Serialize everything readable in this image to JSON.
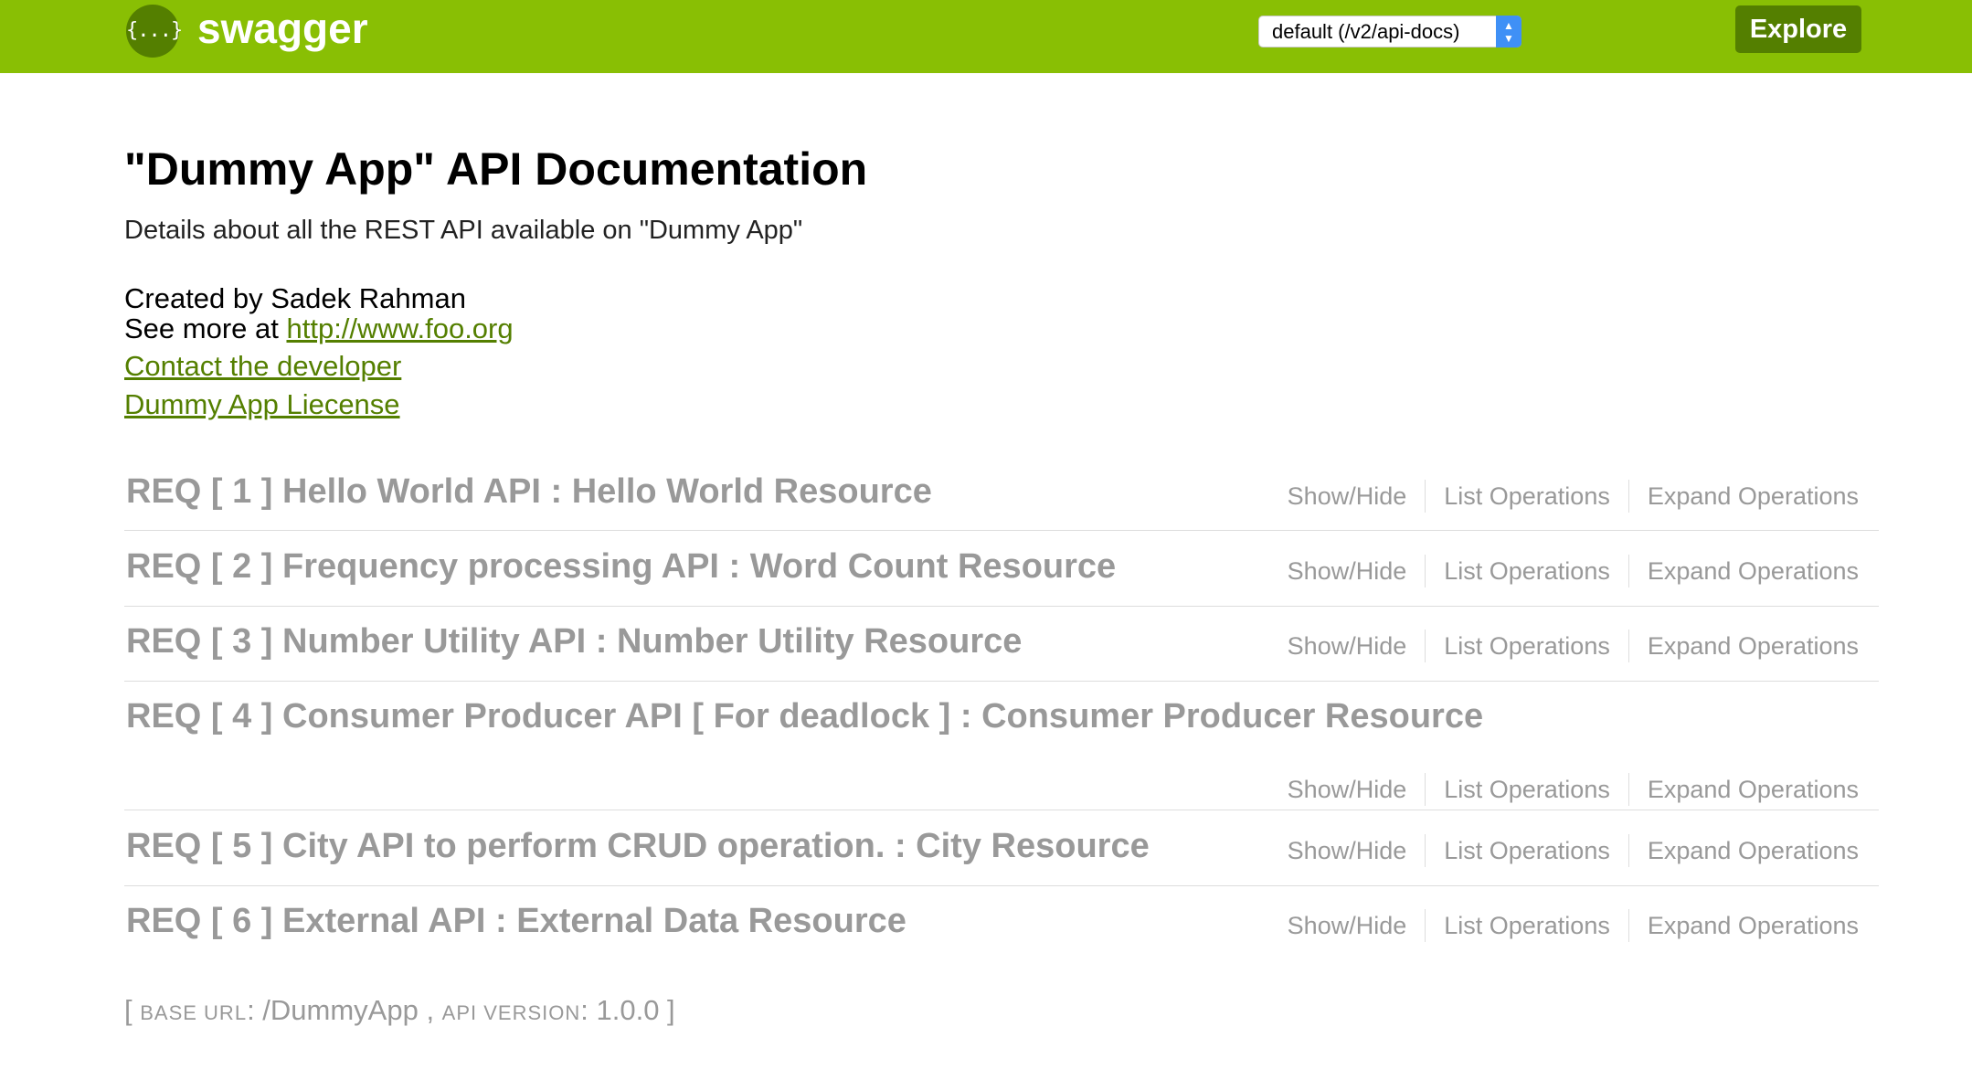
{
  "header": {
    "logo_icon_glyph": "{...}",
    "logo_text": "swagger",
    "spec_select_value": "default (/v2/api-docs)",
    "explore_label": "Explore",
    "background": "#89bf04",
    "accent": "#547f00"
  },
  "info": {
    "title": "\"Dummy App\" API Documentation",
    "description": "Details about all the REST API available on \"Dummy App\"",
    "created_by": "Created by Sadek Rahman",
    "see_more_prefix": "See more at ",
    "see_more_link": "http://www.foo.org",
    "contact_link": "Contact the developer",
    "license_link": "Dummy App Liecense"
  },
  "operations": {
    "show_hide": "Show/Hide",
    "list": "List Operations",
    "expand": "Expand Operations"
  },
  "resources": [
    {
      "title": "REQ [ 1 ] Hello World API : Hello World Resource"
    },
    {
      "title": "REQ [ 2 ] Frequency processing API : Word Count Resource"
    },
    {
      "title": "REQ [ 3 ] Number Utility API : Number Utility Resource"
    },
    {
      "title": "REQ [ 4 ] Consumer Producer API [ For deadlock ] : Consumer Producer Resource"
    },
    {
      "title": "REQ [ 5 ] City API to perform CRUD operation. : City Resource"
    },
    {
      "title": "REQ [ 6 ] External API : External Data Resource"
    }
  ],
  "footer": {
    "open_bracket": "[ ",
    "base_url_label": "base url",
    "base_url_value": ": /DummyApp , ",
    "api_version_label": "api version",
    "api_version_value": ": 1.0.0 ]"
  }
}
